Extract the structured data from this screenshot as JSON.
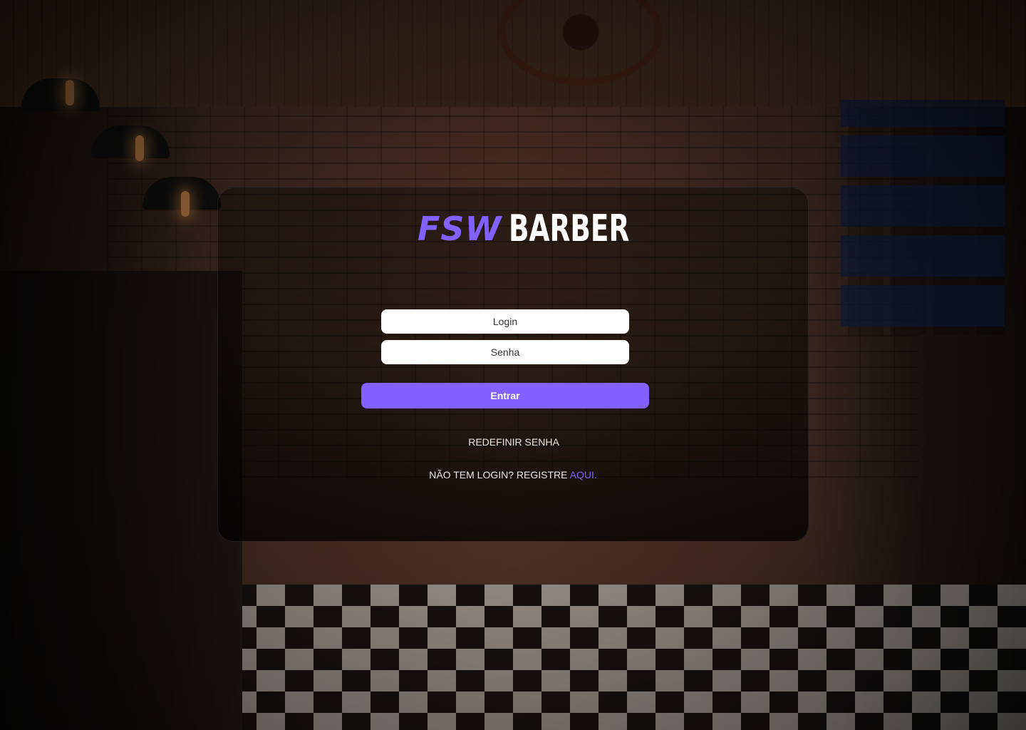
{
  "logo": {
    "mark": "FSW",
    "word": "BARBER"
  },
  "form": {
    "login_placeholder": "Login",
    "password_placeholder": "Senha",
    "submit_label": "Entrar",
    "reset_label": "REDEFINIR SENHA",
    "register_prefix": "NÃO TEM LOGIN? REGISTRE ",
    "register_link": "AQUI."
  },
  "colors": {
    "accent": "#8161ff",
    "text": "#ffffff"
  }
}
